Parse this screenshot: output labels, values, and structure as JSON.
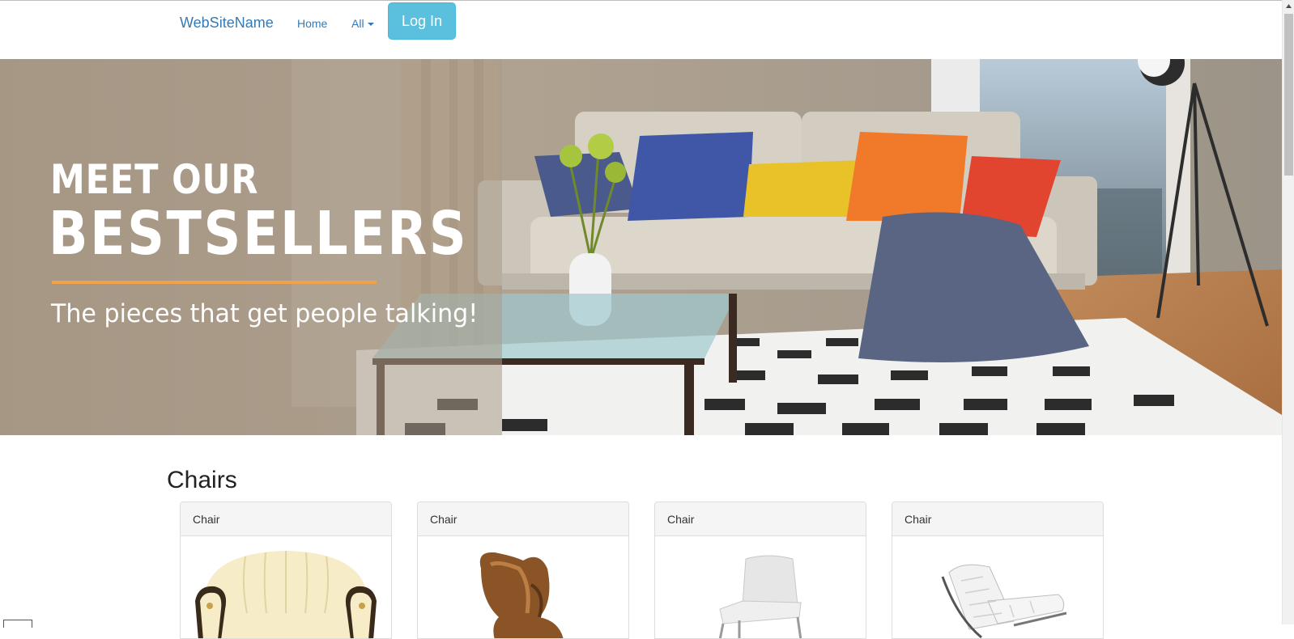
{
  "navbar": {
    "brand": "WebSiteName",
    "links": [
      {
        "label": "Home"
      },
      {
        "label": "All"
      }
    ],
    "login_label": "Log In"
  },
  "hero": {
    "line1": "MEET OUR",
    "line2": "BESTSELLERS",
    "subtitle": "The pieces that get people talking!",
    "accent_color": "#f0a24a"
  },
  "section": {
    "title": "Chairs",
    "cards": [
      {
        "title": "Chair",
        "icon": "cream-armchair-image"
      },
      {
        "title": "Chair",
        "icon": "brown-egg-chair-image"
      },
      {
        "title": "Chair",
        "icon": "white-dining-chair-image"
      },
      {
        "title": "Chair",
        "icon": "white-lounge-chair-image"
      }
    ]
  },
  "colors": {
    "link": "#337ab7",
    "login_button": "#5bc0de"
  }
}
